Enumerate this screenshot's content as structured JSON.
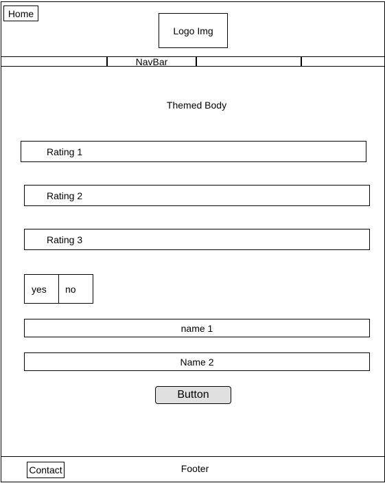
{
  "header": {
    "home_label": "Home",
    "logo_label": "Logo Img"
  },
  "navbar": {
    "label": "NavBar"
  },
  "body": {
    "title": "Themed Body",
    "ratings": [
      "Rating 1",
      "Rating 2",
      "Rating 3"
    ],
    "choices": [
      "yes",
      "no"
    ],
    "name_fields": [
      "name 1",
      "Name 2"
    ],
    "button_label": "Button"
  },
  "footer": {
    "label": "Footer",
    "contact_label": "Contact"
  }
}
